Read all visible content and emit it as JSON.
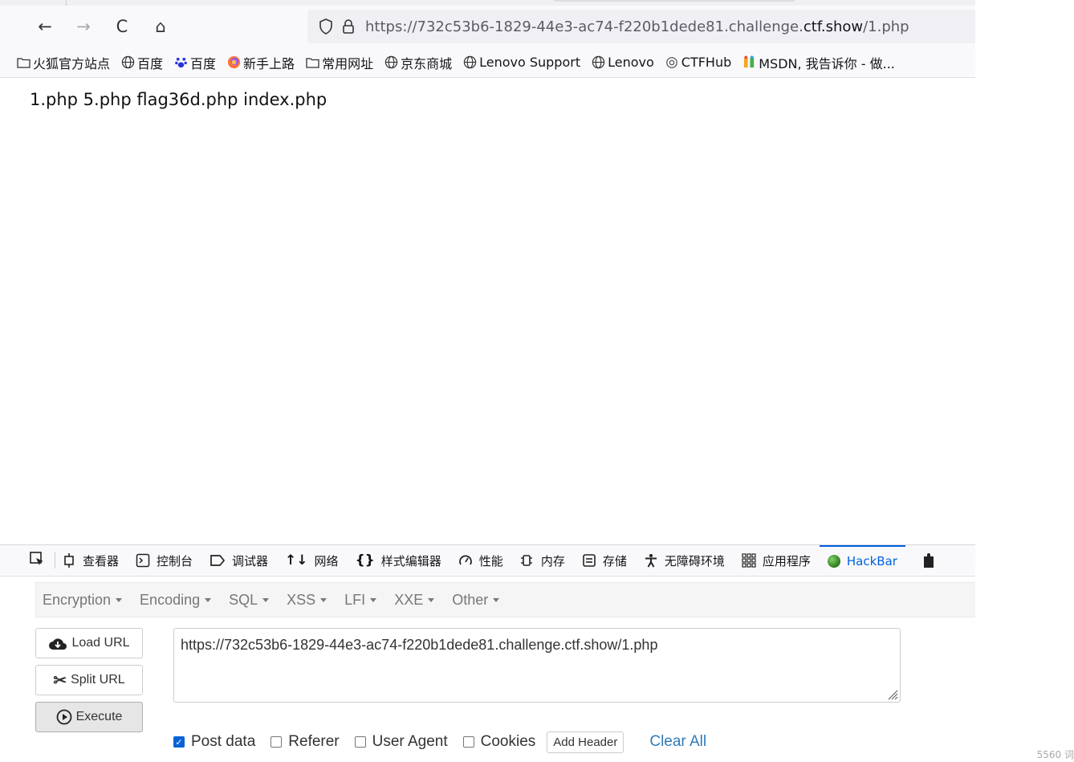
{
  "browser": {
    "url_prefix": "https://732c53b6-1829-44e3-ac74-f220b1dede81.challenge.",
    "url_domain": "ctf.show",
    "url_path": "/1.php",
    "nav": {
      "back": "←",
      "forward": "→",
      "reload": "C",
      "home": "⌂"
    }
  },
  "bookmarks": [
    {
      "label": "火狐官方站点",
      "icon": "folder-icon"
    },
    {
      "label": "百度",
      "icon": "globe-icon"
    },
    {
      "label": "百度",
      "icon": "paw-icon"
    },
    {
      "label": "新手上路",
      "icon": "firefox-icon"
    },
    {
      "label": "常用网址",
      "icon": "folder-icon"
    },
    {
      "label": "京东商城",
      "icon": "globe-icon"
    },
    {
      "label": "Lenovo Support",
      "icon": "globe-icon"
    },
    {
      "label": "Lenovo",
      "icon": "globe-icon"
    },
    {
      "label": "CTFHub",
      "icon": "ctfhub-icon"
    },
    {
      "label": "MSDN, 我告诉你 - 做...",
      "icon": "msdn-icon"
    }
  ],
  "page": {
    "listing": "1.php 5.php flag36d.php index.php"
  },
  "devtools": {
    "tabs": [
      {
        "label": "查看器",
        "icon": "inspector-icon"
      },
      {
        "label": "控制台",
        "icon": "console-icon"
      },
      {
        "label": "调试器",
        "icon": "debugger-icon"
      },
      {
        "label": "网络",
        "icon": "network-icon"
      },
      {
        "label": "样式编辑器",
        "icon": "style-editor-icon"
      },
      {
        "label": "性能",
        "icon": "performance-icon"
      },
      {
        "label": "内存",
        "icon": "memory-icon"
      },
      {
        "label": "存储",
        "icon": "storage-icon"
      },
      {
        "label": "无障碍环境",
        "icon": "accessibility-icon"
      },
      {
        "label": "应用程序",
        "icon": "application-icon"
      },
      {
        "label": "HackBar",
        "icon": "hackbar-icon",
        "active": true
      }
    ]
  },
  "hackbar": {
    "menu": [
      "Encryption",
      "Encoding",
      "SQL",
      "XSS",
      "LFI",
      "XXE",
      "Other"
    ],
    "load_url": "Load URL",
    "split_url": "Split URL",
    "execute": "Execute",
    "url_value": "https://732c53b6-1829-44e3-ac74-f220b1dede81.challenge.ctf.show/1.php",
    "options": {
      "post_data": "Post data",
      "referer": "Referer",
      "user_agent": "User Agent",
      "cookies": "Cookies",
      "post_data_checked": true
    },
    "add_header": "Add Header",
    "clear_all": "Clear All"
  },
  "colors": {
    "accent": "#0061e0",
    "link": "#337ab7",
    "checkbox": "#0b63d6"
  },
  "footer_note": "5560 词"
}
